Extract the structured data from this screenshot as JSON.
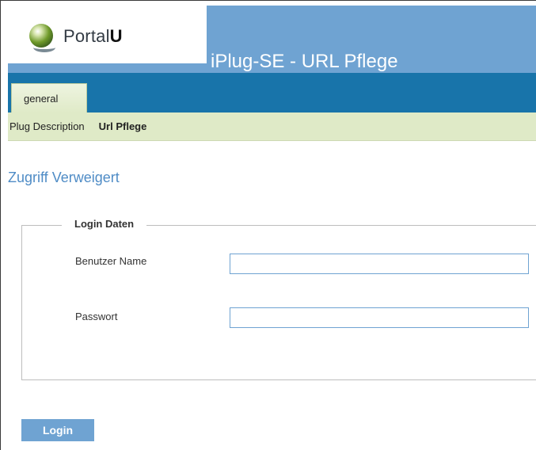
{
  "brand": {
    "logo_text_regular": "Portal",
    "logo_text_bold": "U"
  },
  "header": {
    "app_title": "iPlug-SE - URL Pflege"
  },
  "tabs": [
    {
      "label": "general",
      "active": true
    }
  ],
  "subnav": {
    "items": [
      {
        "label": "Plug Description",
        "active": false
      },
      {
        "label": "Url Pflege",
        "active": true
      }
    ]
  },
  "main": {
    "heading": "Zugriff Verweigert",
    "fieldset": {
      "legend": "Login Daten",
      "username": {
        "label": "Benutzer Name",
        "value": "",
        "placeholder": ""
      },
      "password": {
        "label": "Passwort",
        "value": "",
        "placeholder": ""
      }
    },
    "submit_label": "Login"
  },
  "colors": {
    "header_blue": "#6fa3d2",
    "nav_blue": "#1874aa",
    "subnav_green": "#dfeac7",
    "heading_blue": "#4f8cc6"
  },
  "icons": {
    "logo": "portalu-logo-icon"
  }
}
